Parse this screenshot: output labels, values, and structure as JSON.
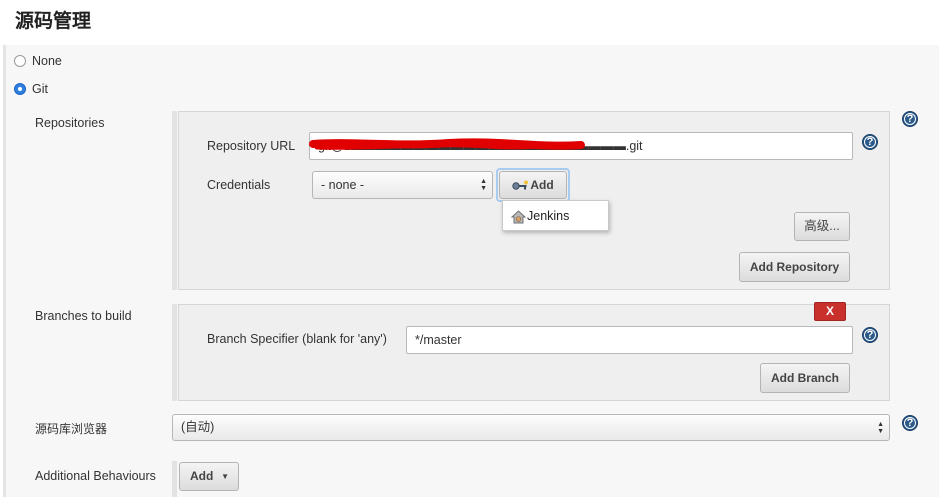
{
  "page": {
    "title": "源码管理"
  },
  "scm": {
    "options": [
      {
        "label": "None",
        "selected": false
      },
      {
        "label": "Git",
        "selected": true
      }
    ]
  },
  "repositories": {
    "label": "Repositories",
    "url_label": "Repository URL",
    "url_value": "git@1▬▬▬▬▬▬▬▬▬▬▬▬▬▬▬▬▬▬▬▬▬▬.git",
    "credentials_label": "Credentials",
    "credentials_value": "- none -",
    "add_label": "Add",
    "add_menu_items": [
      "Jenkins"
    ],
    "advanced_label": "高级...",
    "add_repository_label": "Add Repository"
  },
  "branches": {
    "label": "Branches to build",
    "delete_label": "X",
    "specifier_label": "Branch Specifier (blank for 'any')",
    "specifier_value": "*/master",
    "add_branch_label": "Add Branch"
  },
  "browser": {
    "label": "源码库浏览器",
    "value": "(自动)"
  },
  "behaviours": {
    "label": "Additional Behaviours",
    "add_label": "Add"
  },
  "icons": {
    "help": "help-icon",
    "key": "key-icon",
    "jenkins": "jenkins-icon",
    "dropdown": "chevron-down-icon"
  },
  "colors": {
    "accent": "#2f7fe0",
    "delete": "#c9302c",
    "help": "#2a5a8a",
    "redaction": "#e00000"
  }
}
